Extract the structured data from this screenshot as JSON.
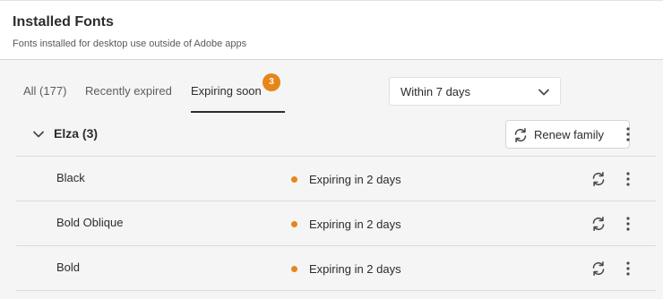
{
  "header": {
    "title": "Installed Fonts",
    "subtitle": "Fonts installed for desktop use outside of Adobe apps"
  },
  "tabs": [
    {
      "label": "All (177)",
      "active": false
    },
    {
      "label": "Recently expired",
      "active": false
    },
    {
      "label": "Expiring soon",
      "active": true,
      "badge": "3"
    }
  ],
  "filter": {
    "selected": "Within 7 days"
  },
  "family": {
    "name": "Elza (3)",
    "renew_label": "Renew family",
    "fonts": [
      {
        "name": "Black",
        "status": "Expiring in 2 days"
      },
      {
        "name": "Bold Oblique",
        "status": "Expiring in 2 days"
      },
      {
        "name": "Bold",
        "status": "Expiring in 2 days"
      }
    ]
  },
  "colors": {
    "accent": "#e68619",
    "text": "#2c2c2c",
    "background": "#f5f5f5"
  },
  "icons": [
    "chevron-down-icon",
    "sync-icon",
    "more-vertical-icon"
  ]
}
